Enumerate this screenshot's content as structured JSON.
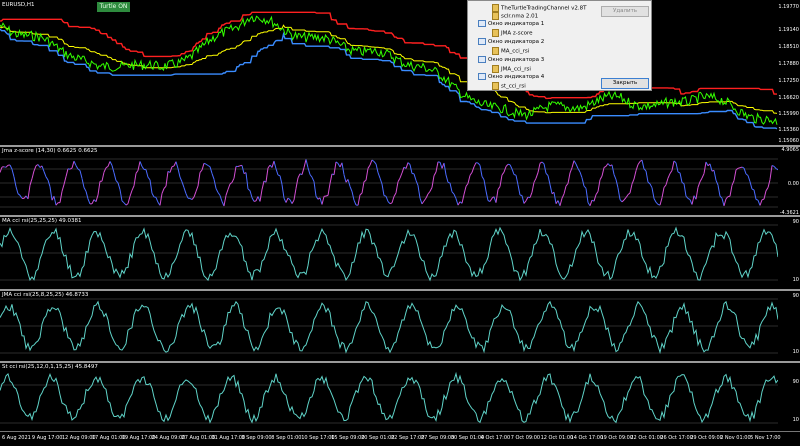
{
  "main": {
    "symbol_label": "EURUSD,H1",
    "status_badge": "Turtle ON",
    "price_ticks": [
      "1.19770",
      "1.19140",
      "1.18510",
      "1.17880",
      "1.17250",
      "1.16620",
      "1.15990",
      "1.15360",
      "1.15060"
    ]
  },
  "panes": [
    {
      "label": "Jma z-score (14,30) 0.6625 0.6625",
      "ticks": [
        "4.9065",
        "0.00",
        "-4.3621"
      ]
    },
    {
      "label": "MA cci rsi(25,25,25) 49.0381",
      "ticks": [
        "90",
        "10"
      ]
    },
    {
      "label": "JMA cci rsi(25,8,25,25) 46.8733",
      "ticks": [
        "90",
        "10"
      ]
    },
    {
      "label": "St cci rsi(25,12,0,1,15,25) 45.8497",
      "ticks": [
        "90",
        "10"
      ]
    }
  ],
  "dialog": {
    "tree": [
      {
        "type": "indicator",
        "text": "TheTurtleTradingChannel v2.8T"
      },
      {
        "type": "indicator",
        "text": "sclr.nma 2.01"
      },
      {
        "type": "window",
        "text": "Окно индикатора 1"
      },
      {
        "type": "indicator",
        "text": "JMA z-score"
      },
      {
        "type": "window",
        "text": "Окно индикатора 2"
      },
      {
        "type": "indicator",
        "text": "MA_cci_rsi"
      },
      {
        "type": "window",
        "text": "Окно индикатора 3"
      },
      {
        "type": "indicator",
        "text": "JMA_cci_rsi"
      },
      {
        "type": "window",
        "text": "Окно индикатора 4"
      },
      {
        "type": "indicator",
        "text": "st_cci_rsi"
      }
    ],
    "delete_label": "Удалить",
    "close_label": "Закрыть"
  },
  "time_axis": [
    "6 Aug 2021",
    "9 Aug 17:00",
    "12 Aug 09:00",
    "17 Aug 01:00",
    "19 Aug 17:00",
    "24 Aug 09:00",
    "27 Aug 01:00",
    "31 Aug 17:00",
    "3 Sep 09:00",
    "8 Sep 01:00",
    "10 Sep 17:00",
    "15 Sep 09:00",
    "20 Sep 01:00",
    "22 Sep 17:00",
    "27 Sep 09:00",
    "30 Sep 01:00",
    "4 Oct 17:00",
    "7 Oct 09:00",
    "12 Oct 01:00",
    "14 Oct 17:00",
    "19 Oct 09:00",
    "22 Oct 01:00",
    "26 Oct 17:00",
    "29 Oct 09:00",
    "2 Nov 01:00",
    "5 Nov 17:00"
  ],
  "colors": {
    "price": "#33ff00",
    "upper": "#ff2020",
    "lower": "#3a8cff",
    "mid": "#ffff00",
    "osc": "#5fd3c8",
    "zscore_a": "#d34fd3",
    "zscore_b": "#4b6bff"
  }
}
